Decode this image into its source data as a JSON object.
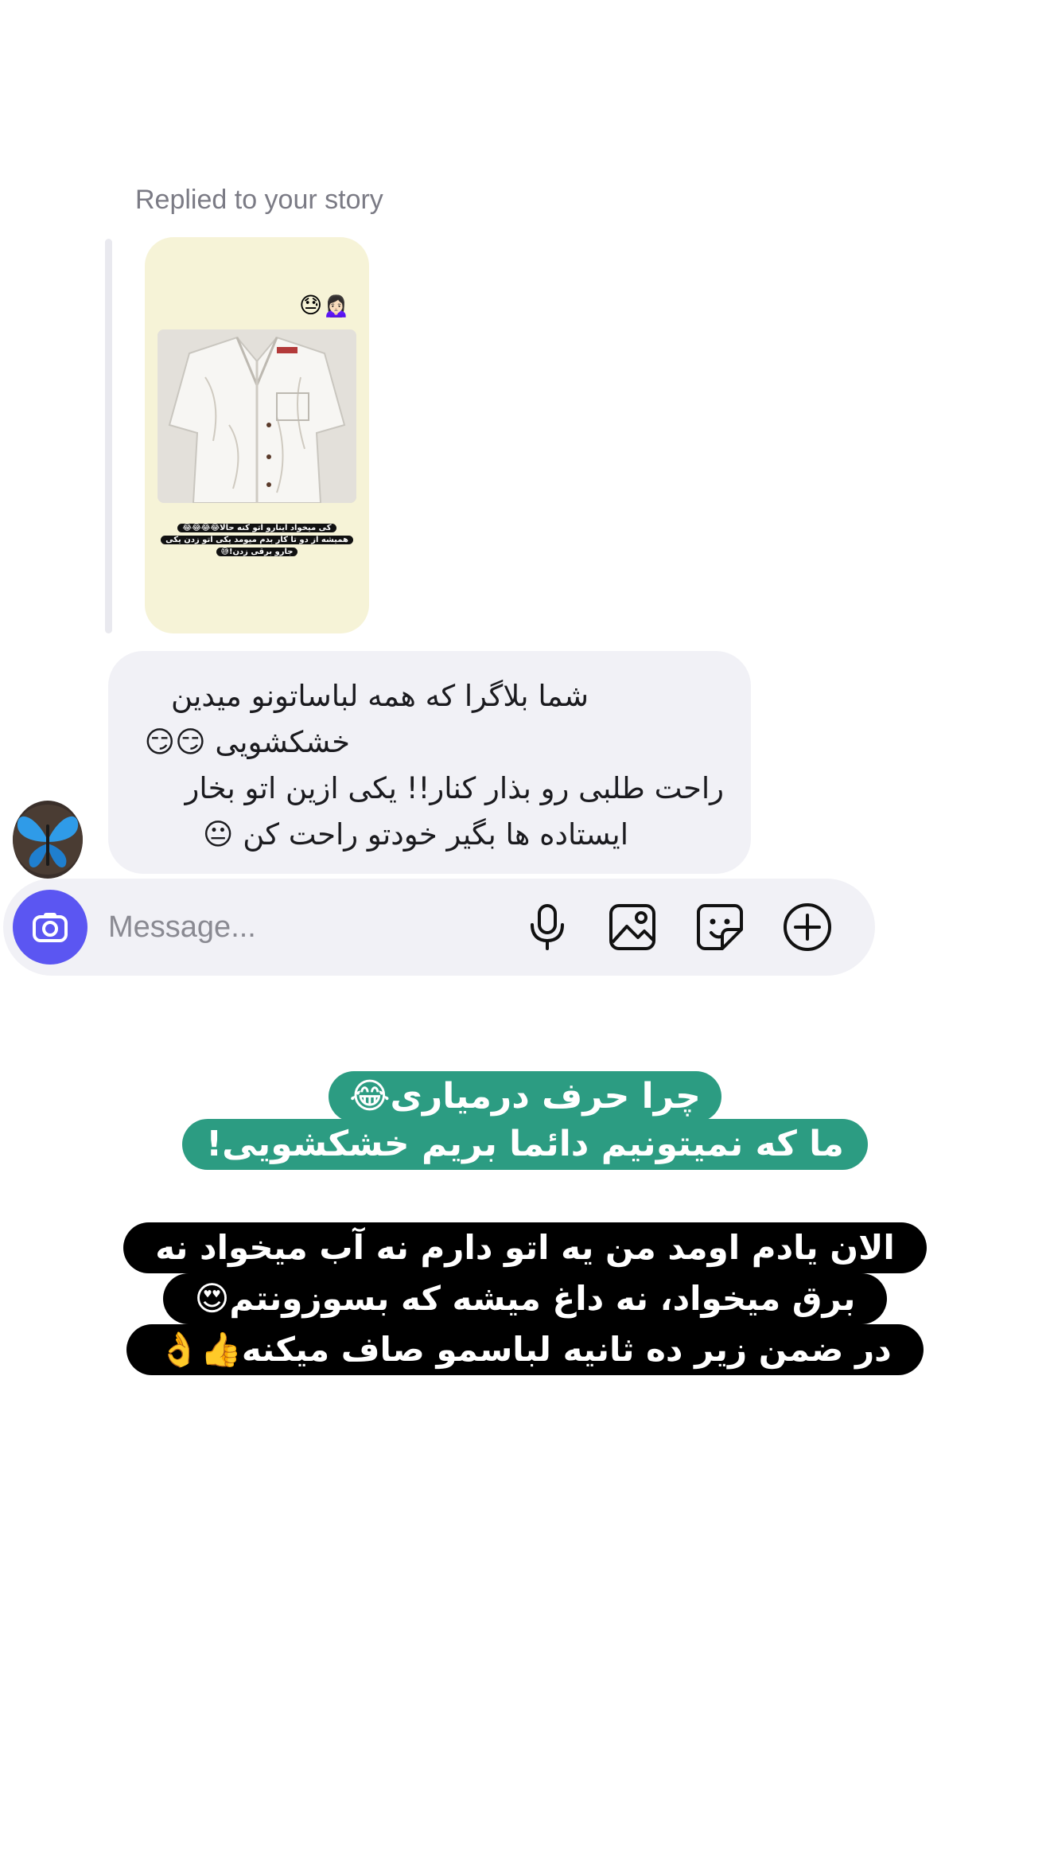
{
  "reply": {
    "caption": "Replied to your story",
    "story": {
      "emoji": "😓🙍🏻‍♀️",
      "caption_lines": [
        "کی میخواد اینارو اتو کنه حالا😂😂😂😂",
        "همیشه از دو تا کار بدم میومد یکی اتو زدن یکی",
        "جارو برقی زدن!😅"
      ]
    }
  },
  "message": {
    "lines": [
      "شما بلاگرا که همه لباساتونو میدین",
      "خشکشویی 😏😏",
      "راحت طلبی رو بذار کنار!!  یکی ازین اتو  بخار",
      "ایستاده ها بگیر خودتو راحت کن 😐"
    ]
  },
  "avatar": {
    "icon": "butterfly-avatar"
  },
  "composer": {
    "placeholder": "Message...",
    "camera_icon": "camera-icon",
    "mic_icon": "microphone-icon",
    "gallery_icon": "gallery-icon",
    "sticker_icon": "sticker-icon",
    "plus_icon": "plus-icon"
  },
  "overlay_green": {
    "lines": [
      "چرا حرف درمیاری😂",
      "ما که نمیتونیم دائما بریم خشکشویی!"
    ],
    "color": "#2c9c82"
  },
  "overlay_black": {
    "lines": [
      "الان یادم اومد من یه اتو دارم نه آب میخواد نه",
      "برق میخواد، نه داغ میشه که بسوزونتم😍",
      "در ضمن زیر ده ثانیه لباسمو صاف میکنه👍👌"
    ]
  },
  "colors": {
    "accent": "#5b56f2",
    "bubble": "#f1f1f6",
    "story_bg": "#f6f3d7"
  }
}
